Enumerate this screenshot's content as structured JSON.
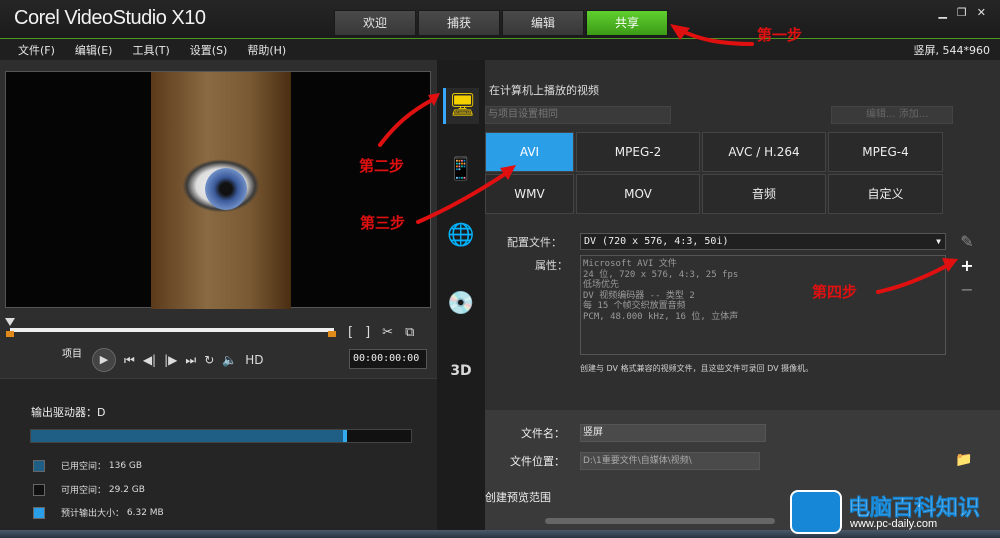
{
  "app": {
    "logo": "Corel VideoStudio X10"
  },
  "tabs": [
    "欢迎",
    "捕获",
    "编辑",
    "共享"
  ],
  "active_tab": "共享",
  "window_controls": [
    "▁",
    "❐",
    "✕"
  ],
  "menu": [
    "文件(F)",
    "编辑(E)",
    "工具(T)",
    "设置(S)",
    "帮助(H)"
  ],
  "aspect_info": "竖屏, 544*960",
  "player": {
    "project_label": "项目",
    "mark_in": "[",
    "mark_out": "]",
    "hd_label": "HD",
    "timecode": "00:00:00:00"
  },
  "drive": {
    "title": "输出驱动器：D",
    "fill_fraction": 0.82,
    "legend": [
      {
        "label": "已用空间：",
        "value": "136 GB",
        "color": "#1f5f86"
      },
      {
        "label": "可用空间：",
        "value": "29.2 GB",
        "color": "#111111"
      },
      {
        "label": "预计输出大小：",
        "value": "6.32 MB",
        "color": "#2b9ee8"
      }
    ]
  },
  "share": {
    "section_title": "在计算机上播放的视频",
    "dropdown1": "与项目设置相同",
    "dropdown2": "编辑... 添加...",
    "formats": [
      "AVI",
      "MPEG-2",
      "AVC / H.264",
      "MPEG-4",
      "WMV",
      "MOV",
      "音频",
      "自定义"
    ],
    "active_format": "AVI",
    "profile_label": "配置文件：",
    "profile_value": "DV (720 x 576, 4:3, 50i)",
    "attr_label": "属性：",
    "attr_lines": [
      "Microsoft AVI 文件",
      "24 位, 720 x 576, 4:3, 25 fps",
      "低场优先",
      "DV 视频编码器 -- 类型 2",
      "每 15 个帧交织放置音频",
      "PCM, 48.000 kHz, 16 位, 立体声"
    ],
    "description": "创建与 DV 格式兼容的视频文件，且这些文件可录回 DV 摄像机。",
    "filename_label": "文件名：",
    "filename_value": "竖屏",
    "filepath_label": "文件位置：",
    "filepath_value": "D:\\1重要文件\\自媒体\\视频\\",
    "preview_range": "创建预览范围"
  },
  "annotations": [
    "第一步",
    "第二步",
    "第三步",
    "第四步"
  ],
  "watermark": {
    "title": "电脑百科知识",
    "url": "www.pc-daily.com"
  }
}
